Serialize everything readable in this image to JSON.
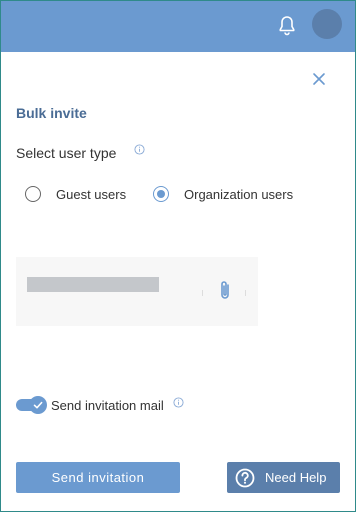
{
  "header": {
    "bell_icon": "bell-icon",
    "avatar": "avatar"
  },
  "dialog": {
    "close_icon": "close-icon",
    "title": "Bulk invite",
    "user_type": {
      "label": "Select user type",
      "info_icon": "info-icon",
      "options": [
        {
          "label": "Guest users",
          "selected": false
        },
        {
          "label": "Organization users",
          "selected": true
        }
      ]
    },
    "upload": {
      "attach_icon": "paperclip-icon"
    },
    "send_mail": {
      "label": "Send invitation mail",
      "enabled": true,
      "info_icon": "info-icon"
    },
    "actions": {
      "send_label": "Send invitation",
      "help_label": "Need Help",
      "help_icon": "question-circle-icon"
    }
  },
  "colors": {
    "accent": "#6b9ad0",
    "accent_dark": "#5b7fab",
    "title": "#4a6c95"
  }
}
